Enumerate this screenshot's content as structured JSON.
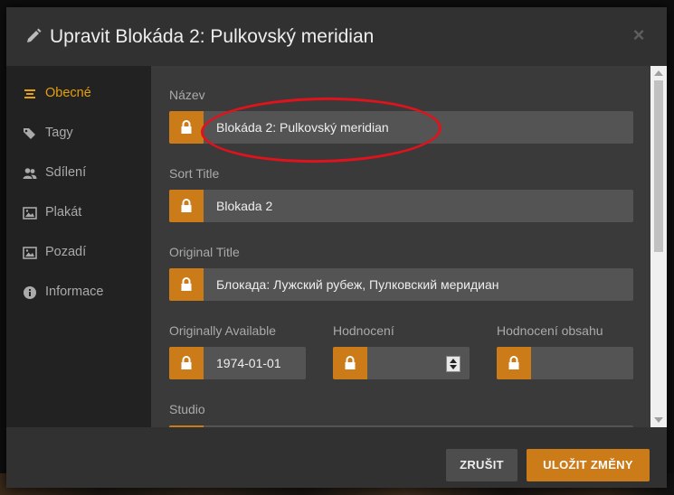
{
  "modal": {
    "title": "Upravit Blokáda 2: Pulkovský meridian",
    "title_icon": "pencil-icon",
    "close_icon": "close-icon",
    "close_glyph": "×"
  },
  "sidebar": {
    "items": [
      {
        "label": "Obecné",
        "icon": "list-icon",
        "active": true
      },
      {
        "label": "Tagy",
        "icon": "tags-icon",
        "active": false
      },
      {
        "label": "Sdílení",
        "icon": "users-icon",
        "active": false
      },
      {
        "label": "Plakát",
        "icon": "image-icon",
        "active": false
      },
      {
        "label": "Pozadí",
        "icon": "image-icon",
        "active": false
      },
      {
        "label": "Informace",
        "icon": "info-icon",
        "active": false
      }
    ]
  },
  "form": {
    "nazev": {
      "label": "Název",
      "value": "Blokáda 2: Pulkovský meridian"
    },
    "sort_title": {
      "label": "Sort Title",
      "value": "Blokada 2"
    },
    "original_title": {
      "label": "Original Title",
      "value": "Блокада: Лужский рубеж, Пулковский меридиан"
    },
    "originally_available": {
      "label": "Originally Available",
      "value": "1974-01-01"
    },
    "hodnoceni": {
      "label": "Hodnocení",
      "value": ""
    },
    "hodnoceni_obsahu": {
      "label": "Hodnocení obsahu",
      "value": ""
    },
    "studio": {
      "label": "Studio",
      "value": ""
    }
  },
  "footer": {
    "cancel_label": "ZRUŠIT",
    "save_label": "ULOŽIT ZMĚNY"
  },
  "colors": {
    "accent": "#e5a00d",
    "lock": "#cc7b19",
    "annotation": "#e0121b"
  }
}
